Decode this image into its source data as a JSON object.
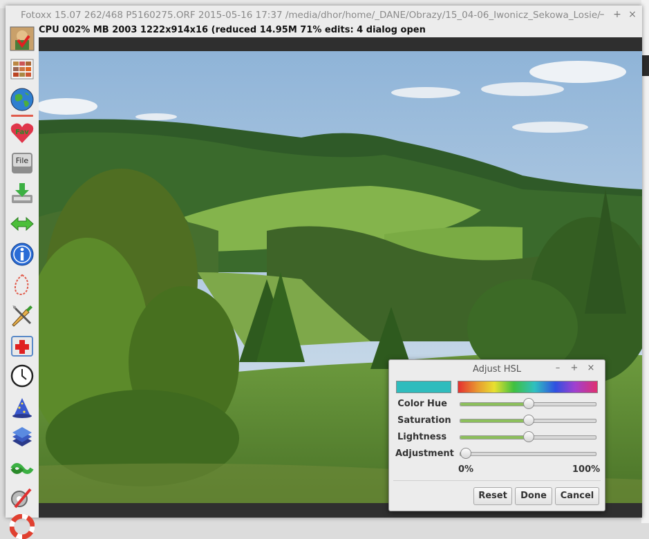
{
  "window": {
    "title": "Fotoxx 15.07  262/468  P5160275.ORF  2015-05-16 17:37  /media/dhor/home/_DANE/Obrazy/15_04-06_Iwonicz_Sekowa_Losie/",
    "minimize_glyph": "–",
    "maximize_glyph": "+",
    "close_glyph": "×"
  },
  "status_line": "CPU 002%  MB 2003  1222x914x16 (reduced  14.95M  71%  edits: 4  dialog open",
  "toolbar": {
    "icons": [
      "thumbnail-icon",
      "gallery-icon",
      "world-map-icon",
      "favorites-icon",
      "file-icon",
      "save-icon",
      "prev-next-icon",
      "info-icon",
      "select-area-icon",
      "edit-tools-icon",
      "repair-icon",
      "clock-icon",
      "effects-icon",
      "layers-icon",
      "process-icon",
      "settings-icon",
      "help-icon"
    ],
    "fav_label": "Fav",
    "file_label": "File"
  },
  "dialog": {
    "title": "Adjust HSL",
    "minimize_glyph": "–",
    "maximize_glyph": "+",
    "close_glyph": "×",
    "swatch_color": "#2fbcbd",
    "sliders": [
      {
        "label": "Color Hue",
        "value": 0.5
      },
      {
        "label": "Saturation",
        "value": 0.5
      },
      {
        "label": "Lightness",
        "value": 0.5
      },
      {
        "label": "Adjustment",
        "value": 0.0
      }
    ],
    "range_min_label": "0%",
    "range_max_label": "100%",
    "buttons": {
      "reset": "Reset",
      "done": "Done",
      "cancel": "Cancel"
    }
  }
}
